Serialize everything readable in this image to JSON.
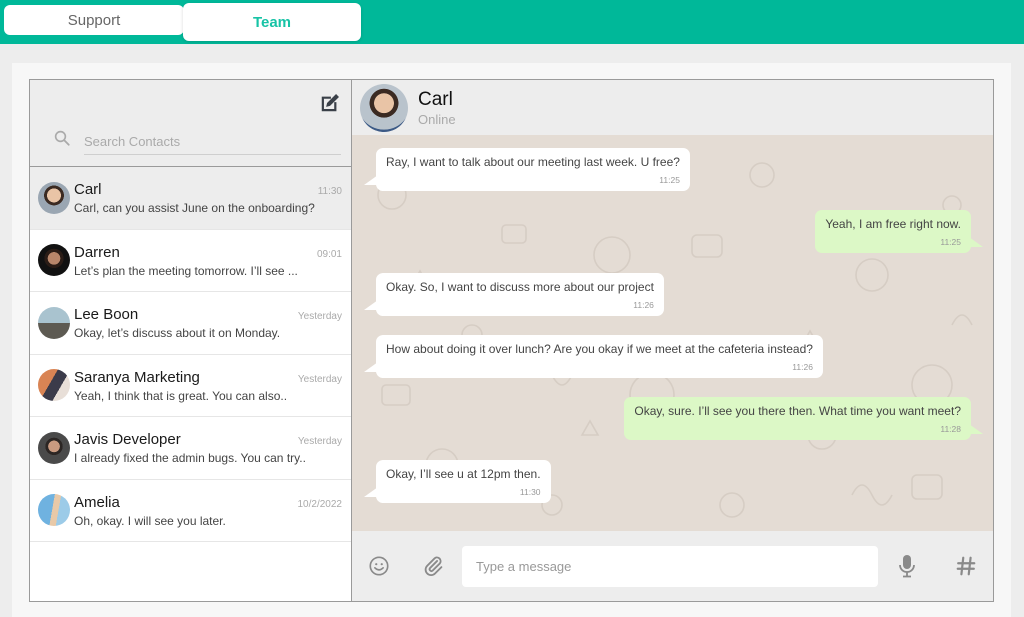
{
  "tabs": [
    {
      "label": "Support",
      "active": false
    },
    {
      "label": "Team",
      "active": true
    }
  ],
  "sidebar": {
    "search_placeholder": "Search Contacts",
    "contacts": [
      {
        "name": "Carl",
        "time": "11:30",
        "preview": "Carl, can you assist June on the onboarding?",
        "active": true
      },
      {
        "name": "Darren",
        "time": "09:01",
        "preview": "Let’s plan the meeting tomorrow. I’ll see ..."
      },
      {
        "name": "Lee Boon",
        "time": "Yesterday",
        "preview": "Okay, let’s discuss about it on Monday."
      },
      {
        "name": "Saranya Marketing",
        "time": "Yesterday",
        "preview": "Yeah, I think that is great. You can also.."
      },
      {
        "name": "Javis Developer",
        "time": "Yesterday",
        "preview": "I already fixed the admin bugs. You can try.."
      },
      {
        "name": "Amelia",
        "time": "10/2/2022",
        "preview": "Oh, okay. I will see you later."
      }
    ]
  },
  "chat": {
    "name": "Carl",
    "status": "Online",
    "messages": [
      {
        "dir": "in",
        "text": "Ray, I want to talk about our meeting last week. U free?",
        "time": "11:25"
      },
      {
        "dir": "out",
        "text": "Yeah, I am free right now.",
        "time": "11:25"
      },
      {
        "dir": "in",
        "text": "Okay. So, I want to discuss more about our project",
        "time": "11:26"
      },
      {
        "dir": "in",
        "text": "How about doing it over lunch? Are you okay if we meet at the cafeteria instead?",
        "time": "11:26"
      },
      {
        "dir": "out",
        "text": "Okay, sure. I’ll see you there then. What time you want meet?",
        "time": "11:28"
      },
      {
        "dir": "in",
        "text": "Okay, I’ll see u at 12pm then.",
        "time": "11:30"
      }
    ],
    "composer_placeholder": "Type a message"
  },
  "colors": {
    "brand": "#00b899",
    "tab_active_text": "#17c3a6",
    "bubble_out": "#dcf8c6",
    "bubble_in": "#ffffff",
    "chat_bg": "#e4dcd4"
  }
}
